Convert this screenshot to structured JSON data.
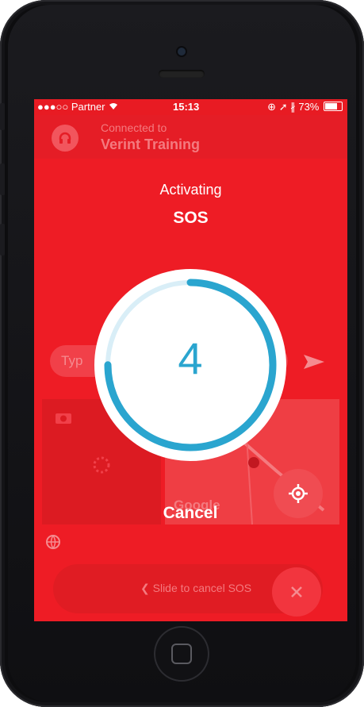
{
  "status_bar": {
    "carrier": "●●●○○ Partner",
    "time": "15:13",
    "battery": "73%"
  },
  "header": {
    "connected_label": "Connected to",
    "workspace_name": "Verint Training"
  },
  "message_input": {
    "placeholder": "Typ"
  },
  "map": {
    "provider_label": "Google"
  },
  "slider": {
    "label": "❮ Slide to cancel SOS"
  },
  "sos_overlay": {
    "activating_label": "Activating",
    "sos_label": "SOS",
    "countdown_value": "4",
    "countdown_progress": 0.75,
    "cancel_label": "Cancel"
  },
  "colors": {
    "background_red": "#ee1c25",
    "ring_blue": "#2aa5cf",
    "ring_track": "#d9eef7"
  },
  "icons": [
    "wifi-icon",
    "headset-icon",
    "send-icon",
    "camera-icon",
    "locate-icon",
    "globe-icon",
    "close-icon"
  ]
}
